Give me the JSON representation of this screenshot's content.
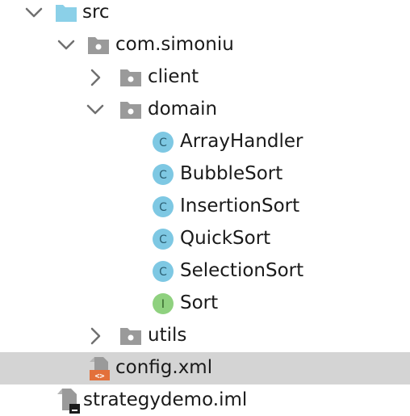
{
  "tree": {
    "src": {
      "label": "src",
      "icon": "source-folder-icon",
      "expanded": true
    },
    "package": {
      "label": "com.simoniu",
      "icon": "package-icon",
      "expanded": true
    },
    "client": {
      "label": "client",
      "icon": "package-icon",
      "expanded": false
    },
    "domain": {
      "label": "domain",
      "icon": "package-icon",
      "expanded": true
    },
    "classes": [
      {
        "label": "ArrayHandler",
        "icon": "class-icon",
        "glyph": "C"
      },
      {
        "label": "BubbleSort",
        "icon": "class-icon",
        "glyph": "C"
      },
      {
        "label": "InsertionSort",
        "icon": "class-icon",
        "glyph": "C"
      },
      {
        "label": "QuickSort",
        "icon": "class-icon",
        "glyph": "C"
      },
      {
        "label": "SelectionSort",
        "icon": "class-icon",
        "glyph": "C"
      },
      {
        "label": "Sort",
        "icon": "interface-icon",
        "glyph": "I"
      }
    ],
    "utils": {
      "label": "utils",
      "icon": "package-icon",
      "expanded": false
    },
    "config": {
      "label": "config.xml",
      "icon": "xml-file-icon",
      "selected": true
    },
    "iml": {
      "label": "strategydemo.iml",
      "icon": "iml-file-icon"
    }
  },
  "colors": {
    "source_folder": "#8bd0e8",
    "package_folder": "#9a9a9a",
    "class_badge": "#7ec8e3",
    "interface_badge": "#8fd17f",
    "xml_accent": "#e3703b",
    "selected_row": "#d4d4d4",
    "chevron": "#707070"
  }
}
